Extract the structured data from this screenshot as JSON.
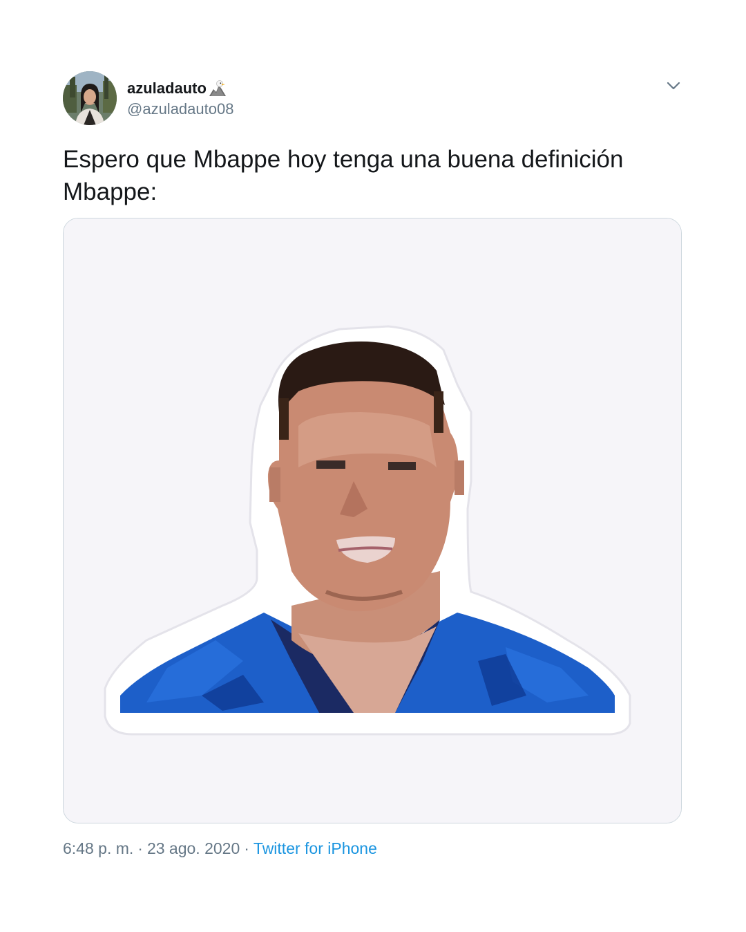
{
  "tweet": {
    "display_name": "azuladauto",
    "display_name_emoji": "eagle-emoji",
    "handle": "@azuladauto08",
    "text_line1": "Espero que Mbappe hoy tenga una buena definición",
    "text_line2": "Mbappe:",
    "time": "6:48 p. m.",
    "separator": "·",
    "date": "23 ago. 2020",
    "source": "Twitter for iPhone"
  },
  "icons": {
    "menu": "chevron-down-icon",
    "avatar": "avatar"
  },
  "colors": {
    "text": "#14171a",
    "secondary": "#657786",
    "link": "#1b95e0",
    "media_background": "#f6f5f9",
    "border": "#ccd6dd"
  }
}
